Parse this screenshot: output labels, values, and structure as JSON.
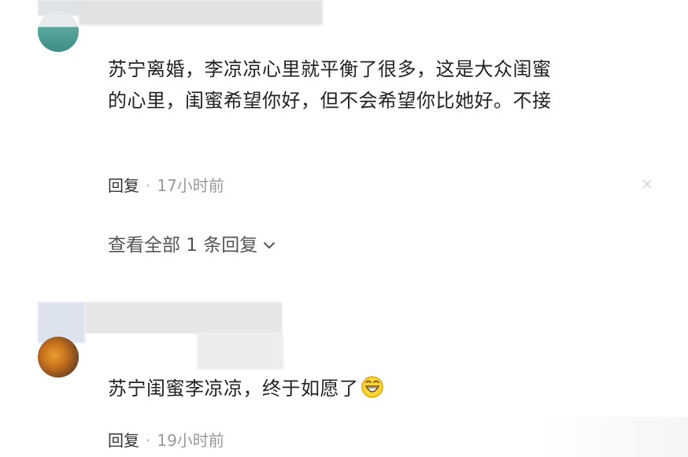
{
  "comments": [
    {
      "text_line1": "苏宁离婚，李凉凉心里就平衡了很多，这是大众闺蜜",
      "text_line2": "的心里，闺蜜希望你好，但不会希望你比她好。不接",
      "reply_label": "回复",
      "separator": "·",
      "time": "17小时前",
      "view_all_replies": "查看全部 1 条回复"
    },
    {
      "text": "苏宁闺蜜李凉凉，终于如愿了",
      "reply_label": "回复",
      "separator": "·",
      "time": "19小时前"
    }
  ],
  "icons": {
    "close": "close-icon",
    "chevron": "chevron-down-icon",
    "emoji": "grinning-face-emoji"
  },
  "colors": {
    "text": "#222222",
    "meta": "#999999",
    "link": "#333333"
  }
}
